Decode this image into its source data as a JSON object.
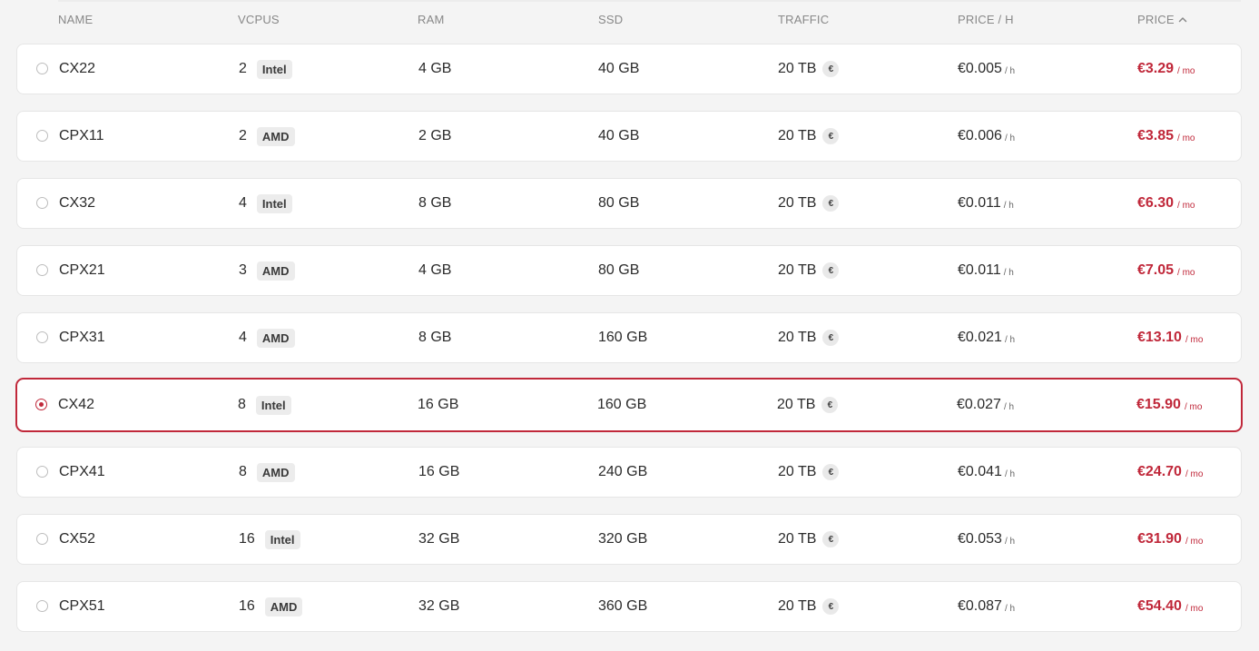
{
  "headers": {
    "name": "NAME",
    "vcpus": "VCPUS",
    "ram": "RAM",
    "ssd": "SSD",
    "traffic": "TRAFFIC",
    "price_h": "PRICE / H",
    "price": "PRICE"
  },
  "sort": {
    "column": "price",
    "direction": "ascending",
    "icon": "chevron-up-icon"
  },
  "units": {
    "per_hour": "/ h",
    "per_month": "/ mo",
    "traffic_icon": "€"
  },
  "colors": {
    "accent": "#c0283a",
    "badge_bg": "#ececec"
  },
  "rows": [
    {
      "name": "CX22",
      "vcpus": "2",
      "cpu": "Intel",
      "ram": "4 GB",
      "ssd": "40 GB",
      "traffic": "20 TB",
      "price_h": "€0.005",
      "price": "€3.29",
      "selected": false
    },
    {
      "name": "CPX11",
      "vcpus": "2",
      "cpu": "AMD",
      "ram": "2 GB",
      "ssd": "40 GB",
      "traffic": "20 TB",
      "price_h": "€0.006",
      "price": "€3.85",
      "selected": false
    },
    {
      "name": "CX32",
      "vcpus": "4",
      "cpu": "Intel",
      "ram": "8 GB",
      "ssd": "80 GB",
      "traffic": "20 TB",
      "price_h": "€0.011",
      "price": "€6.30",
      "selected": false
    },
    {
      "name": "CPX21",
      "vcpus": "3",
      "cpu": "AMD",
      "ram": "4 GB",
      "ssd": "80 GB",
      "traffic": "20 TB",
      "price_h": "€0.011",
      "price": "€7.05",
      "selected": false
    },
    {
      "name": "CPX31",
      "vcpus": "4",
      "cpu": "AMD",
      "ram": "8 GB",
      "ssd": "160 GB",
      "traffic": "20 TB",
      "price_h": "€0.021",
      "price": "€13.10",
      "selected": false
    },
    {
      "name": "CX42",
      "vcpus": "8",
      "cpu": "Intel",
      "ram": "16 GB",
      "ssd": "160 GB",
      "traffic": "20 TB",
      "price_h": "€0.027",
      "price": "€15.90",
      "selected": true
    },
    {
      "name": "CPX41",
      "vcpus": "8",
      "cpu": "AMD",
      "ram": "16 GB",
      "ssd": "240 GB",
      "traffic": "20 TB",
      "price_h": "€0.041",
      "price": "€24.70",
      "selected": false
    },
    {
      "name": "CX52",
      "vcpus": "16",
      "cpu": "Intel",
      "ram": "32 GB",
      "ssd": "320 GB",
      "traffic": "20 TB",
      "price_h": "€0.053",
      "price": "€31.90",
      "selected": false
    },
    {
      "name": "CPX51",
      "vcpus": "16",
      "cpu": "AMD",
      "ram": "32 GB",
      "ssd": "360 GB",
      "traffic": "20 TB",
      "price_h": "€0.087",
      "price": "€54.40",
      "selected": false
    }
  ]
}
